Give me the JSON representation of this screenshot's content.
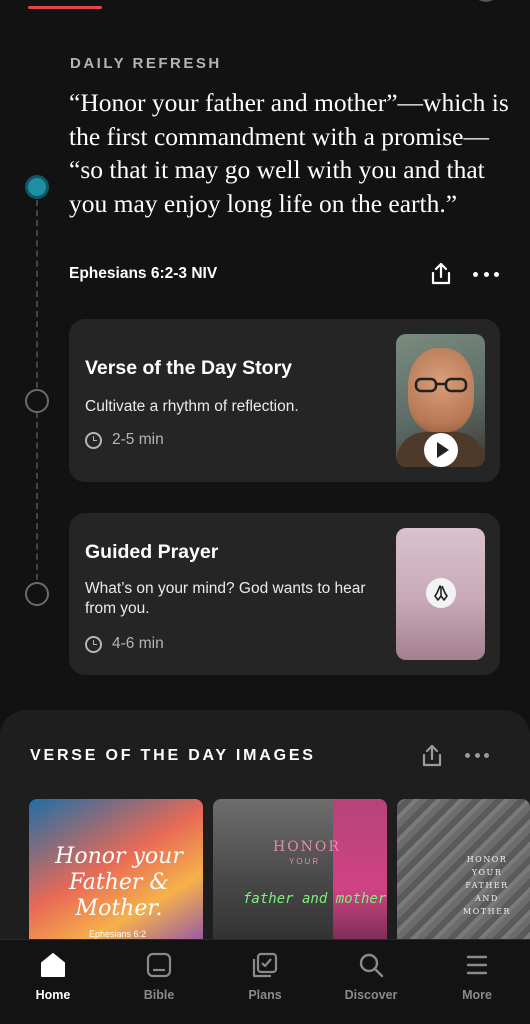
{
  "daily": {
    "section_label": "DAILY REFRESH",
    "quote": "“Honor your father and mother”—which is the first commandment with a promise— “so that it may go well with you and that you may enjoy long life on the earth.”",
    "reference": "Ephesians 6:2-3 NIV",
    "share_icon": "share-icon",
    "more_icon": "more-icon"
  },
  "cards": [
    {
      "title": "Verse of the Day Story",
      "subtitle": "Cultivate a rhythm of reflection.",
      "duration": "2-5 min",
      "thumb_icon": "play-icon"
    },
    {
      "title": "Guided Prayer",
      "subtitle": "What’s on your mind? God wants to hear from you.",
      "duration": "4-6 min",
      "thumb_icon": "praying-hands-icon"
    }
  ],
  "images_section": {
    "title": "VERSE OF THE DAY IMAGES",
    "images": [
      {
        "text": "Honor your Father & Mother.",
        "ref": "Ephesians 6:2"
      },
      {
        "honor": "HONOR",
        "your": "YOUR",
        "father_mother": "father and mother"
      },
      {
        "text": "HONOR YOUR FATHER AND MOTHER"
      }
    ]
  },
  "tabs": [
    {
      "label": "Home",
      "icon": "home-icon",
      "active": true
    },
    {
      "label": "Bible",
      "icon": "bible-icon",
      "active": false
    },
    {
      "label": "Plans",
      "icon": "plans-icon",
      "active": false
    },
    {
      "label": "Discover",
      "icon": "search-icon",
      "active": false
    },
    {
      "label": "More",
      "icon": "menu-icon",
      "active": false
    }
  ],
  "colors": {
    "background": "#121212",
    "card": "#252525",
    "accent_red": "#e2464b",
    "timeline_active": "#1f8fa3"
  }
}
